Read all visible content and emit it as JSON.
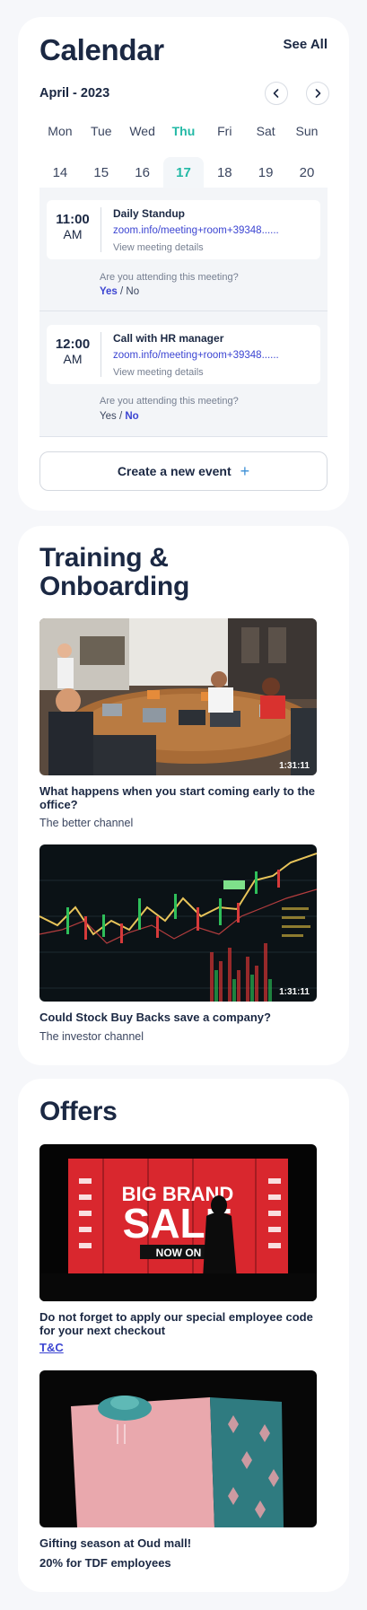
{
  "calendar": {
    "title": "Calendar",
    "see_all": "See All",
    "month": "April - 2023",
    "days": [
      "Mon",
      "Tue",
      "Wed",
      "Thu",
      "Fri",
      "Sat",
      "Sun"
    ],
    "dates": [
      "14",
      "15",
      "16",
      "17",
      "18",
      "19",
      "20"
    ],
    "selected_index": 3,
    "events": [
      {
        "time": "11:00",
        "ampm": "AM",
        "title": "Daily Standup",
        "link": "zoom.info/meeting+room+39348......",
        "details": "View meeting details",
        "question": "Are you attending this meeting?",
        "yes": "Yes",
        "slash": " / ",
        "no": "No",
        "response": "yes"
      },
      {
        "time": "12:00",
        "ampm": "AM",
        "title": "Call with HR manager",
        "link": "zoom.info/meeting+room+39348......",
        "details": "View meeting details",
        "question": "Are you attending this meeting?",
        "yes": "Yes",
        "slash": " / ",
        "no": "No",
        "response": "no"
      }
    ],
    "create_event": "Create a new event",
    "create_icon": "+"
  },
  "training": {
    "title_line1": "Training &",
    "title_line2": "Onboarding",
    "videos": [
      {
        "title": "What happens when you start coming early to the office?",
        "channel": "The better channel",
        "duration": "1:31:11"
      },
      {
        "title": "Could Stock Buy Backs save a company?",
        "channel": "The investor channel",
        "duration": "1:31:11"
      }
    ]
  },
  "offers": {
    "title": "Offers",
    "items": [
      {
        "text": "Do not forget to apply our special employee code for your next checkout",
        "link": "T&C"
      },
      {
        "text_line1": "Gifting season at Oud mall!",
        "text_line2": "20% for TDF employees"
      }
    ],
    "sale_image": {
      "brand": "BIG BRAND",
      "sale": "SALE",
      "now_on": "NOW ON"
    }
  },
  "colors": {
    "accent": "#23b9a6",
    "link": "#3c45d2",
    "heading": "#1b2843"
  }
}
